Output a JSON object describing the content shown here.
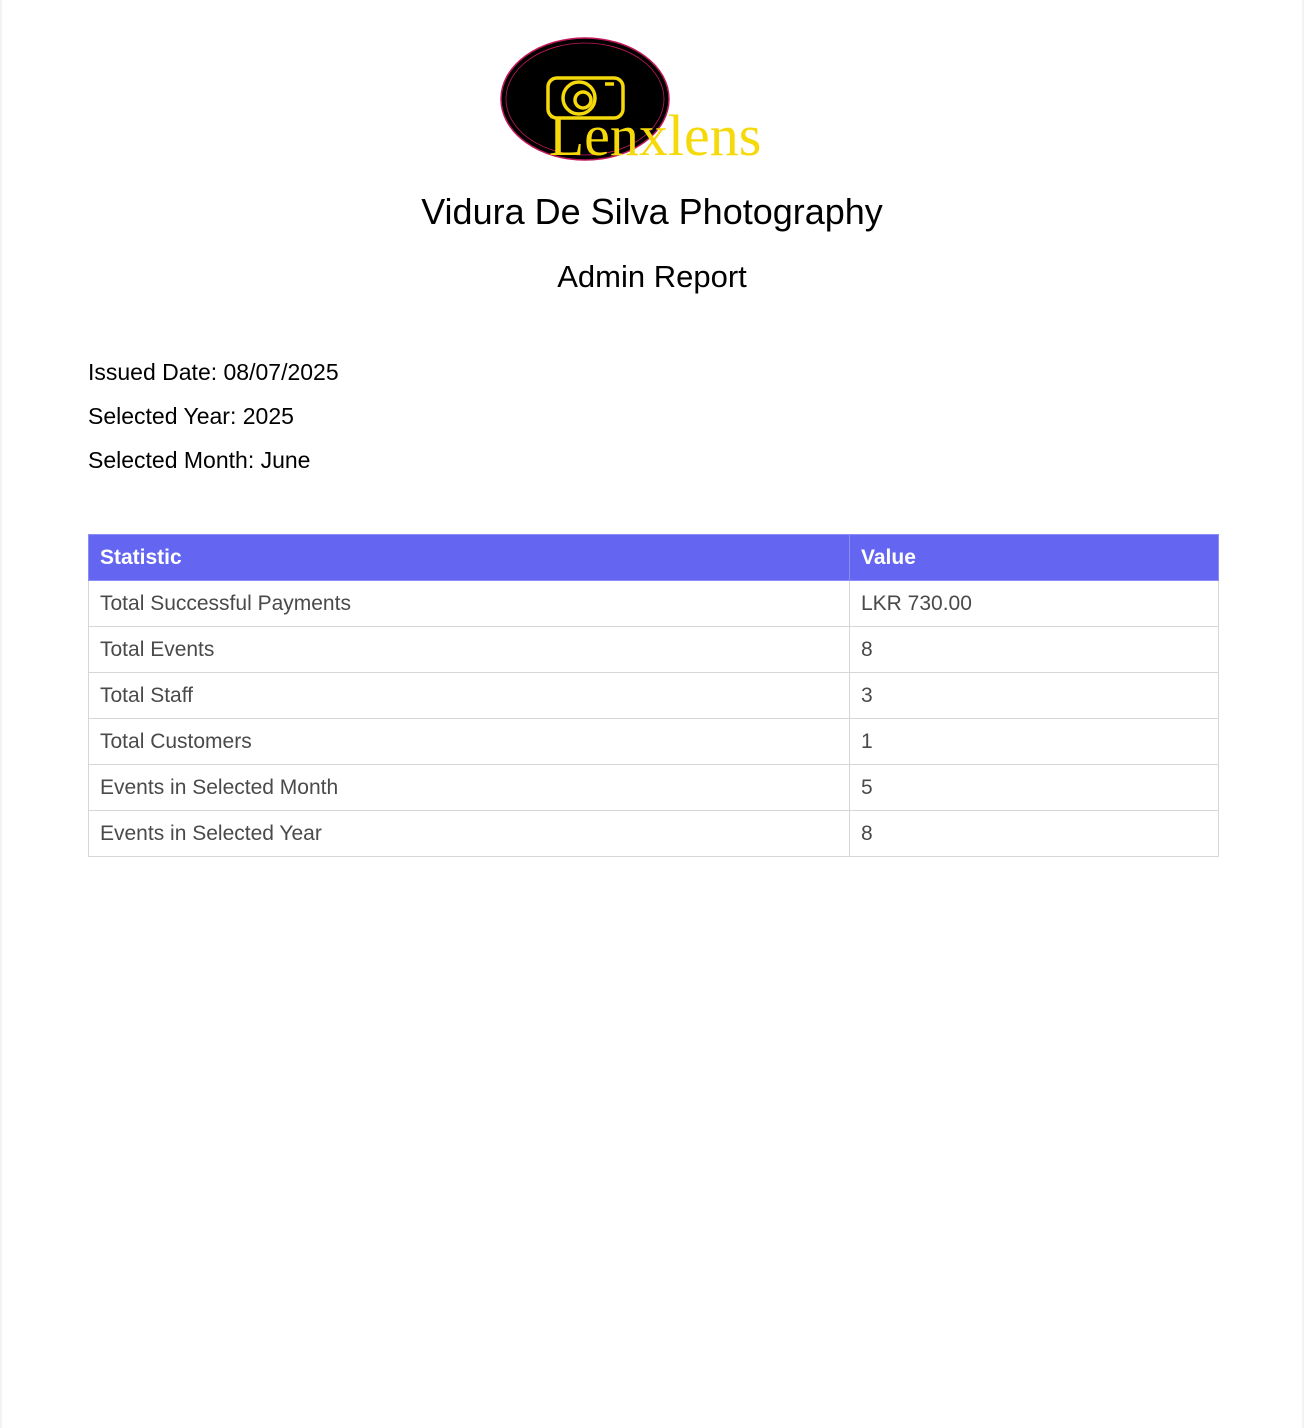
{
  "logo": {
    "brand_text": "Lenxlens",
    "icon": "camera-icon",
    "colors": {
      "circle": "#000000",
      "outline": "#c2185b",
      "accent": "#f5d90a"
    }
  },
  "header": {
    "company": "Vidura De Silva Photography",
    "report_title": "Admin Report"
  },
  "meta": {
    "issued_date": "Issued Date: 08/07/2025",
    "selected_year": "Selected Year: 2025",
    "selected_month": "Selected Month: June"
  },
  "table": {
    "headers": [
      "Statistic",
      "Value"
    ],
    "header_color": "#6466f1",
    "rows": [
      {
        "statistic": "Total Successful Payments",
        "value": "LKR 730.00"
      },
      {
        "statistic": "Total Events",
        "value": "8"
      },
      {
        "statistic": "Total Staff",
        "value": "3"
      },
      {
        "statistic": "Total Customers",
        "value": "1"
      },
      {
        "statistic": "Events in Selected Month",
        "value": "5"
      },
      {
        "statistic": "Events in Selected Year",
        "value": "8"
      }
    ]
  }
}
